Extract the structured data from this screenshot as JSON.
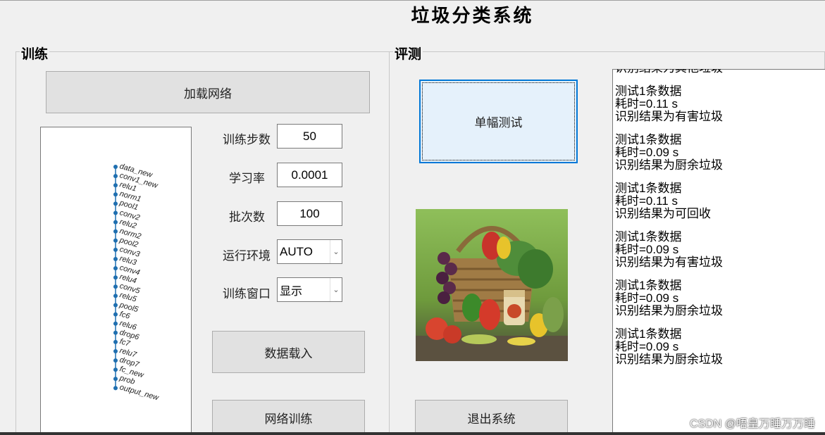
{
  "app": {
    "title": "垃圾分类系统"
  },
  "training": {
    "group_label": "训练",
    "load_network_label": "加载网络",
    "layers": [
      "data_new",
      "conv1_new",
      "relu1",
      "norm1",
      "pool1",
      "conv2",
      "relu2",
      "norm2",
      "pool2",
      "conv3",
      "relu3",
      "conv4",
      "relu4",
      "conv5",
      "relu5",
      "pool5",
      "fc6",
      "relu6",
      "drop6",
      "fc7",
      "relu7",
      "drop7",
      "fc_new",
      "prob",
      "output_new"
    ],
    "params": {
      "steps_label": "训练步数",
      "steps_value": "50",
      "lr_label": "学习率",
      "lr_value": "0.0001",
      "batch_label": "批次数",
      "batch_value": "100",
      "env_label": "运行环境",
      "env_value": "AUTO",
      "window_label": "训练窗口",
      "window_value": "显示"
    },
    "load_data_label": "数据载入",
    "train_label": "网络训练"
  },
  "evaluation": {
    "group_label": "评测",
    "single_test_label": "单幅测试",
    "exit_label": "退出系统"
  },
  "log": {
    "lines": [
      "识别结果为其他垃圾",
      "",
      "测试1条数据",
      "耗时=0.11 s",
      "识别结果为有害垃圾",
      "",
      "测试1条数据",
      "耗时=0.09 s",
      "识别结果为厨余垃圾",
      "",
      "测试1条数据",
      "耗时=0.11 s",
      "识别结果为可回收",
      "",
      "测试1条数据",
      "耗时=0.09 s",
      "识别结果为有害垃圾",
      "",
      "测试1条数据",
      "耗时=0.09 s",
      "识别结果为厨余垃圾",
      "",
      "测试1条数据",
      "耗时=0.09 s",
      "识别结果为厨余垃圾"
    ]
  },
  "watermark": "CSDN @唔皇万睡万万睡",
  "colors": {
    "layer_node": "#1f6fb0",
    "focus_border": "#0078d7"
  }
}
